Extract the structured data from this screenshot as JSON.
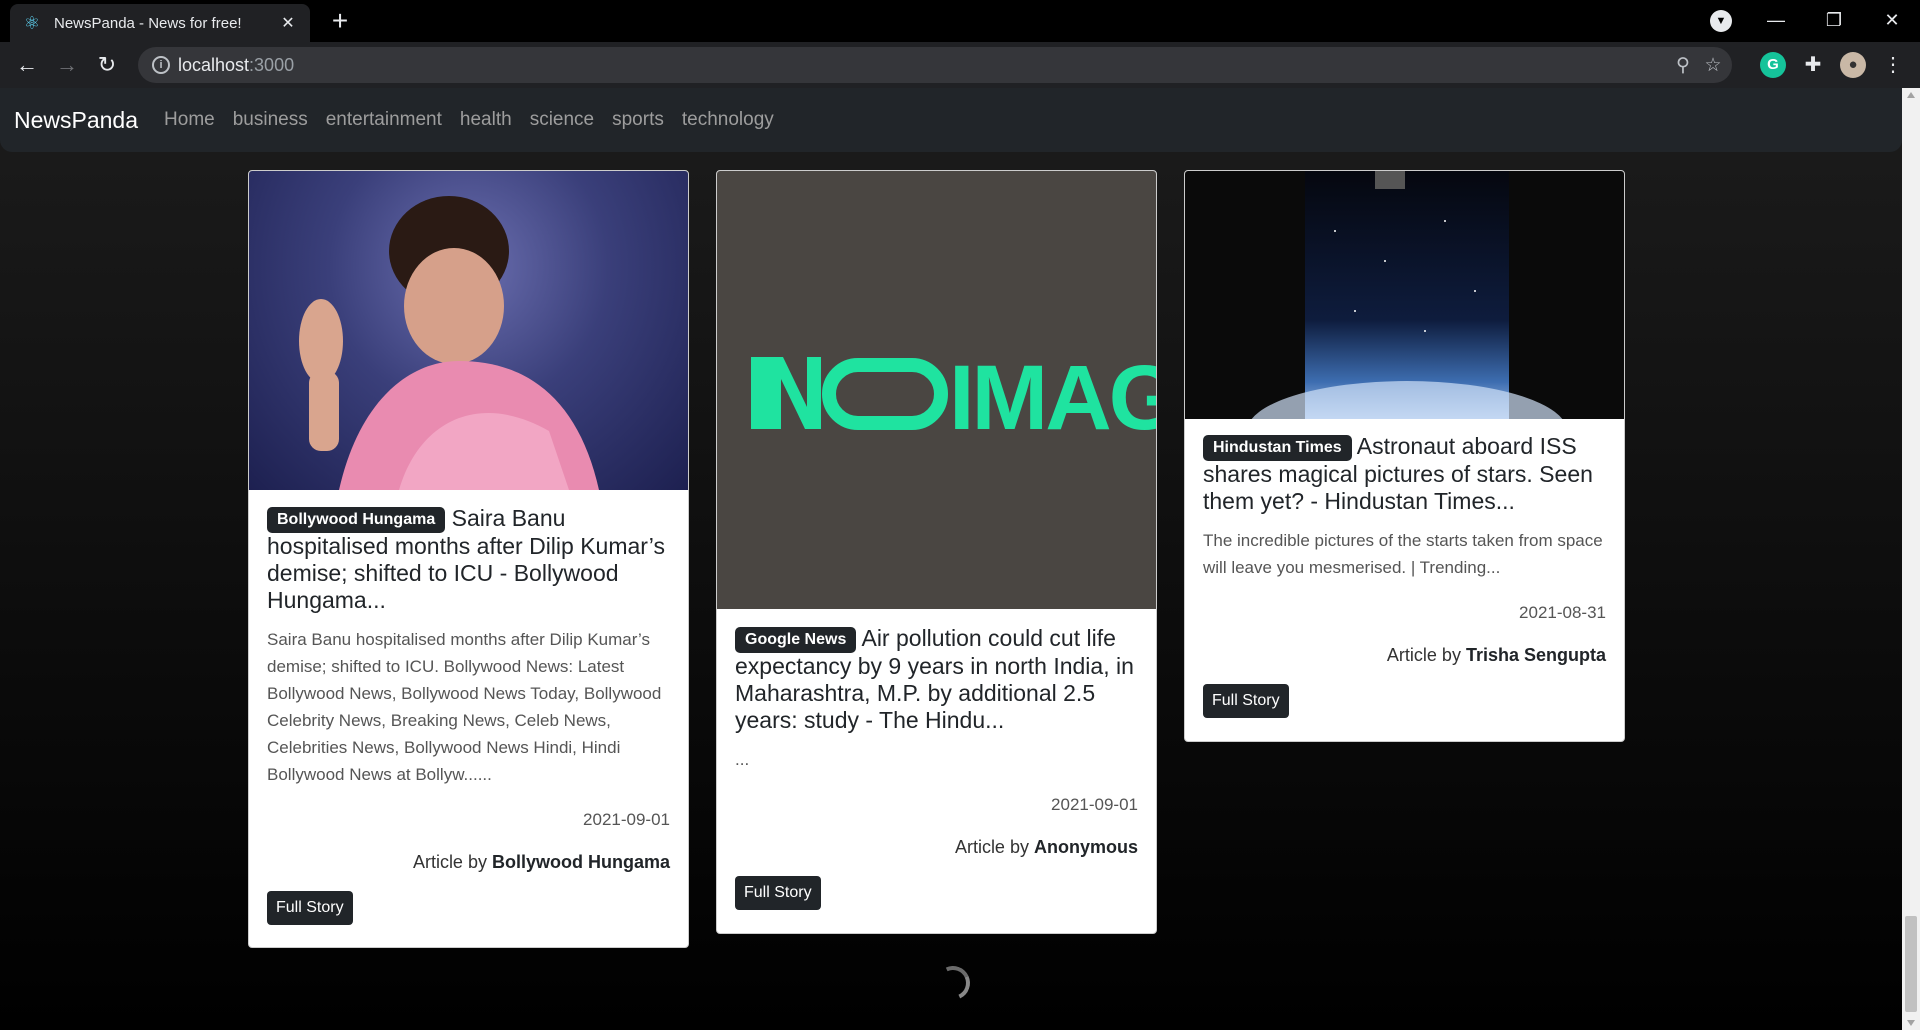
{
  "browser": {
    "tab_title": "NewsPanda - News for free!",
    "tab_close": "✕",
    "new_tab": "+",
    "url_host": "localhost",
    "url_port": ":3000",
    "icons": [
      "react-favicon",
      "back-arrow",
      "forward-arrow",
      "reload",
      "site-info",
      "zoom",
      "bookmark-star",
      "grammarly",
      "extensions-puzzle",
      "profile-avatar",
      "menu-dots",
      "tab-search",
      "minimize",
      "restore",
      "close"
    ]
  },
  "navbar": {
    "brand": "NewsPanda",
    "links": [
      "Home",
      "business",
      "entertainment",
      "health",
      "science",
      "sports",
      "technology"
    ]
  },
  "cards": [
    {
      "source": "Bollywood Hungama",
      "title": "Saira Banu hospitalised months after Dilip Kumar’s demise; shifted to ICU - Bollywood Hungama...",
      "description": "Saira Banu hospitalised months after Dilip Kumar’s demise; shifted to ICU. Bollywood News: Latest Bollywood News, Bollywood News Today, Bollywood Celebrity News, Breaking News, Celeb News, Celebrities News, Bollywood News Hindi, Hindi Bollywood News at Bollyw......",
      "date": "2021-09-01",
      "author_prefix": "Article by",
      "author": "Bollywood Hungama",
      "button": "Full Story"
    },
    {
      "source": "Google News",
      "title": "Air pollution could cut life expectancy by 9 years in north India, in Maharashtra, M.P. by additional 2.5 years: study - The Hindu...",
      "description": "...",
      "image_text": "IMAGE",
      "date": "2021-09-01",
      "author_prefix": "Article by",
      "author": "Anonymous",
      "button": "Full Story"
    },
    {
      "source": "Hindustan Times",
      "title": "Astronaut aboard ISS shares magical pictures of stars. Seen them yet? - Hindustan Times...",
      "description": "The incredible pictures of the starts taken from space will leave you mesmerised. | Trending...",
      "date": "2021-08-31",
      "author_prefix": "Article by",
      "author": "Trisha Sengupta",
      "button": "Full Story"
    }
  ],
  "colors": {
    "navbar_bg": "#212529",
    "no_image_green": "#1fe3a0",
    "no_image_bg": "#4a4642"
  }
}
